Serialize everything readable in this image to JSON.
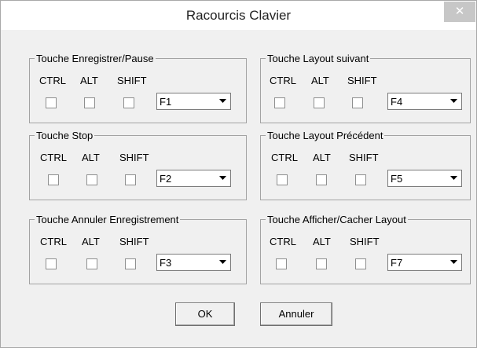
{
  "window": {
    "title": "Racourcis Clavier",
    "close_glyph": "✕"
  },
  "modifiers": {
    "ctrl": "CTRL",
    "alt": "ALT",
    "shift": "SHIFT"
  },
  "groups": [
    {
      "caption": "Touche Enregistrer/Pause",
      "ctrl": false,
      "alt": false,
      "shift": false,
      "key": "F1"
    },
    {
      "caption": "Touche Layout suivant",
      "ctrl": false,
      "alt": false,
      "shift": false,
      "key": "F4"
    },
    {
      "caption": "Touche Stop",
      "ctrl": false,
      "alt": false,
      "shift": false,
      "key": "F2"
    },
    {
      "caption": "Touche Layout Précédent",
      "ctrl": false,
      "alt": false,
      "shift": false,
      "key": "F5"
    },
    {
      "caption": "Touche Annuler Enregistrement",
      "ctrl": false,
      "alt": false,
      "shift": false,
      "key": "F3"
    },
    {
      "caption": "Touche Afficher/Cacher Layout",
      "ctrl": false,
      "alt": false,
      "shift": false,
      "key": "F7"
    }
  ],
  "buttons": {
    "ok": "OK",
    "cancel": "Annuler"
  },
  "icons": {
    "close": "close-icon",
    "dropdown": "chevron-down-icon"
  },
  "colors": {
    "dialog_bg": "#f0f0f0",
    "titlebar_bg": "#ffffff",
    "close_bg": "#c7c7c7",
    "frame_border": "#a3a3a3"
  }
}
